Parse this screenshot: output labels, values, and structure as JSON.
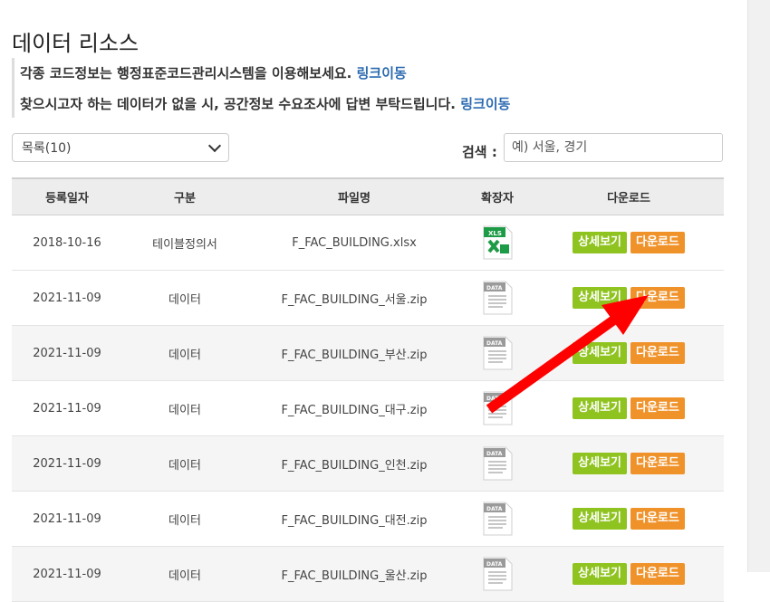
{
  "page": {
    "title": "데이터 리소스",
    "notice_line1": "각종 코드정보는 행정표준코드관리시스템을 이용해보세요.",
    "notice_line2": "찾으시고자 하는 데이터가 없을 시, 공간정보 수요조사에 답변 부탁드립니다.",
    "link_label": "링크이동"
  },
  "controls": {
    "list_select_value": "목록(10)",
    "search_label": "검색 :",
    "search_placeholder": "예) 서울, 경기"
  },
  "table": {
    "headers": [
      "등록일자",
      "구분",
      "파일명",
      "확장자",
      "다운로드"
    ],
    "detail_label": "상세보기",
    "download_label": "다운로드",
    "rows": [
      {
        "date": "2018-10-16",
        "category": "테이블정의서",
        "file": "F_FAC_BUILDING.xlsx",
        "ext_icon": "excel-file-icon",
        "ext_text": "XLS"
      },
      {
        "date": "2021-11-09",
        "category": "데이터",
        "file": "F_FAC_BUILDING_서울.zip",
        "ext_icon": "data-file-icon",
        "ext_text": "DATA"
      },
      {
        "date": "2021-11-09",
        "category": "데이터",
        "file": "F_FAC_BUILDING_부산.zip",
        "ext_icon": "data-file-icon",
        "ext_text": "DATA"
      },
      {
        "date": "2021-11-09",
        "category": "데이터",
        "file": "F_FAC_BUILDING_대구.zip",
        "ext_icon": "data-file-icon",
        "ext_text": "DATA"
      },
      {
        "date": "2021-11-09",
        "category": "데이터",
        "file": "F_FAC_BUILDING_인천.zip",
        "ext_icon": "data-file-icon",
        "ext_text": "DATA"
      },
      {
        "date": "2021-11-09",
        "category": "데이터",
        "file": "F_FAC_BUILDING_대전.zip",
        "ext_icon": "data-file-icon",
        "ext_text": "DATA"
      },
      {
        "date": "2021-11-09",
        "category": "데이터",
        "file": "F_FAC_BUILDING_울산.zip",
        "ext_icon": "data-file-icon",
        "ext_text": "DATA"
      }
    ]
  },
  "colors": {
    "link": "#2b6ab0",
    "detail_button": "#8fc31f",
    "download_button": "#f0922a",
    "annotation_arrow": "#ff0000",
    "excel_green": "#1e9b47"
  },
  "annotation": {
    "arrow_icon": "red-arrow-icon",
    "points_to": "row 2 download button"
  }
}
